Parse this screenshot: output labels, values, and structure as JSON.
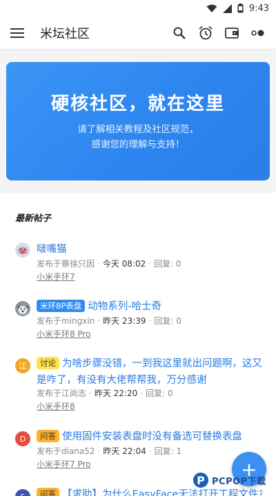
{
  "status_bar": {
    "time": "9:43"
  },
  "app_bar": {
    "title": "米坛社区"
  },
  "banner": {
    "headline": "硬核社区，就在这里",
    "line1": "请了解相关教程及社区规范，",
    "line2": "感谢您的理解与支持！"
  },
  "section": {
    "title": "最新帖子"
  },
  "posts": [
    {
      "tag": "",
      "title": "啵嘴猫",
      "author": "发布于蔡徐只因",
      "time": "今天 08:02",
      "replies": "回复: 0",
      "board": "小米手环7",
      "avatar": "pig"
    },
    {
      "tag": "米环8P表盘",
      "title": "动物系列-哈士奇",
      "author": "发布于mingxin",
      "time": "昨天 23:39",
      "replies": "回复: 0",
      "board": "小米手环8 Pro",
      "avatar": "dog"
    },
    {
      "tag": "讨论",
      "title": "为啥步骤没错，一到我这里就出问题啊，这又是咋了，有没有大佬帮帮我，万分感谢",
      "author": "发布于江尚志",
      "time": "昨天 22:20",
      "replies": "回复: 0",
      "board": "小米手环8",
      "avatar": "江"
    },
    {
      "tag": "问答",
      "title": "使用固件安装表盘时没有备选可替换表盘",
      "author": "发布于diana52",
      "time": "昨天 22:04",
      "replies": "回复: 1",
      "board": "小米手环7 Pro",
      "avatar": "D"
    },
    {
      "tag": "问答",
      "title": "【求助】为什么EasyFace无法打开工程文件?",
      "avatar": "S"
    }
  ],
  "fab": {
    "icon": "+"
  },
  "watermark": {
    "text": "PCPOP下载",
    "logo": "P"
  },
  "colors": {
    "accent": "#2f8bf0",
    "banner": "#2c84ee"
  }
}
